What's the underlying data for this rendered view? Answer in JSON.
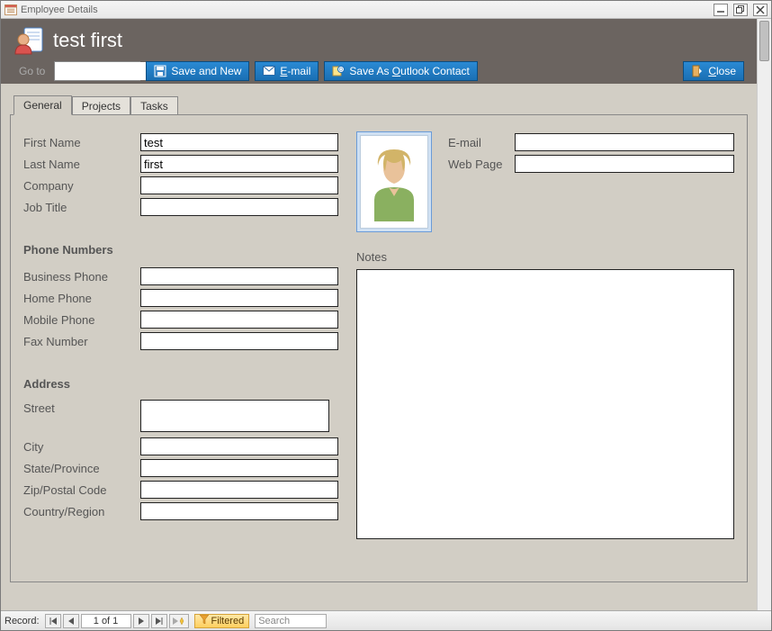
{
  "window": {
    "title": "Employee Details"
  },
  "header": {
    "title": "test first",
    "goto_label": "Go to",
    "goto_value": ""
  },
  "toolbar": {
    "save_new": "Save and New",
    "email_prefix": "E",
    "email_suffix": "-mail",
    "save_outlook_prefix": "Save As ",
    "save_outlook_u": "O",
    "save_outlook_suffix": "utlook Contact",
    "close_u": "C",
    "close_suffix": "lose"
  },
  "tabs": {
    "general": "General",
    "projects": "Projects",
    "tasks": "Tasks"
  },
  "labels": {
    "first_name": "First Name",
    "last_name": "Last Name",
    "company": "Company",
    "job_title": "Job Title",
    "phone_hdr": "Phone Numbers",
    "bus_phone": "Business Phone",
    "home_phone": "Home Phone",
    "mobile_phone": "Mobile Phone",
    "fax": "Fax Number",
    "address_hdr": "Address",
    "street": "Street",
    "city": "City",
    "state": "State/Province",
    "zip": "Zip/Postal Code",
    "country": "Country/Region",
    "email": "E-mail",
    "web": "Web Page",
    "notes": "Notes"
  },
  "values": {
    "first_name": "test",
    "last_name": "first",
    "company": "",
    "job_title": "",
    "bus_phone": "",
    "home_phone": "",
    "mobile_phone": "",
    "fax": "",
    "street": "",
    "city": "",
    "state": "",
    "zip": "",
    "country": "",
    "email": "",
    "web": "",
    "notes": ""
  },
  "recnav": {
    "label": "Record:",
    "counter": "1 of 1",
    "filtered": "Filtered",
    "search": "Search"
  }
}
